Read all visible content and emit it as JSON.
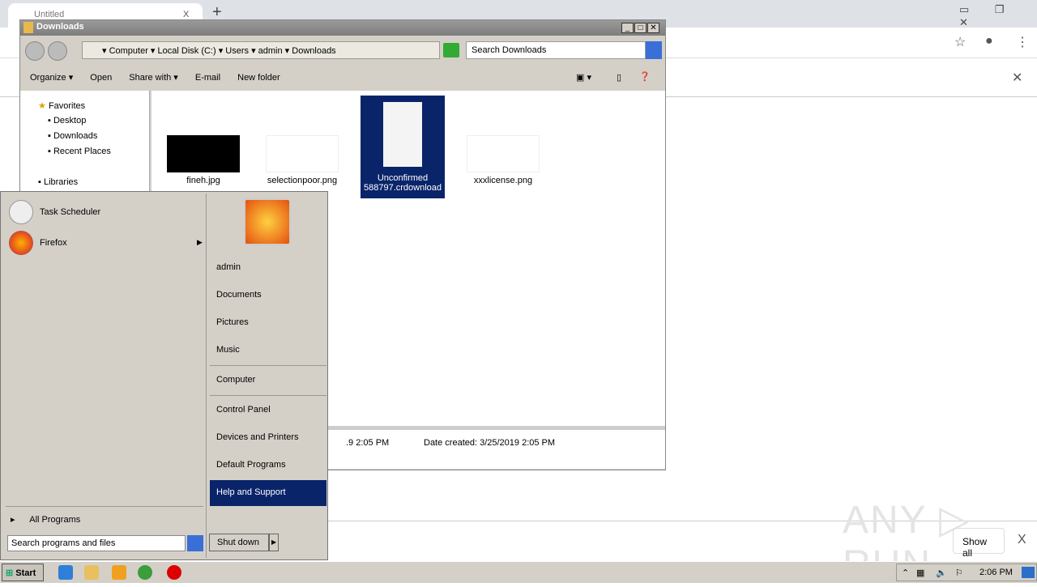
{
  "browser": {
    "tab_title": "Untitled",
    "new_tab": "+",
    "close_tab": "X",
    "show_all": "Show all",
    "close_bar": "X",
    "close_info": "✕"
  },
  "explorer": {
    "title": "Downloads",
    "breadcrumb": [
      "Computer",
      "Local Disk (C:)",
      "Users",
      "admin",
      "Downloads"
    ],
    "search_placeholder": "Search Downloads",
    "toolbar": {
      "organize": "Organize ▾",
      "open": "Open",
      "share": "Share with ▾",
      "email": "E-mail",
      "new_folder": "New folder"
    },
    "nav": {
      "favorites": "Favorites",
      "desktop": "Desktop",
      "downloads": "Downloads",
      "recent": "Recent Places",
      "libraries": "Libraries"
    },
    "files": [
      {
        "name": "fineh.jpg"
      },
      {
        "name": "selectionpoor.png"
      },
      {
        "name": "Unconfirmed 588797.crdownload",
        "selected": true
      },
      {
        "name": "xxxlicense.png"
      }
    ],
    "details": {
      "modified": ".9 2:05 PM",
      "created": "Date created:  3/25/2019 2:05 PM"
    }
  },
  "start_menu": {
    "programs": [
      {
        "label": "Task Scheduler"
      },
      {
        "label": "Firefox"
      }
    ],
    "all_programs": "All Programs",
    "search_placeholder": "Search programs and files",
    "shutdown": "Shut down",
    "right": [
      "admin",
      "Documents",
      "Pictures",
      "Music",
      "Computer",
      "Control Panel",
      "Devices and Printers",
      "Default Programs",
      "Help and Support"
    ],
    "highlighted": "Help and Support",
    "highlight_color": "#0a246a"
  },
  "taskbar": {
    "start": "Start",
    "clock": "2:06 PM"
  },
  "watermark": "ANY RUN"
}
